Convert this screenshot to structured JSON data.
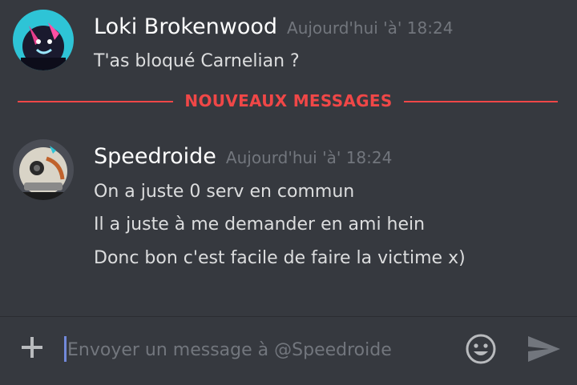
{
  "messages": [
    {
      "username": "Loki Brokenwood",
      "timestamp": "Aujourd'hui 'à' 18:24",
      "lines": [
        "T'as bloqué Carnelian ?"
      ]
    },
    {
      "username": "Speedroide",
      "timestamp": "Aujourd'hui 'à' 18:24",
      "lines": [
        "On a juste 0 serv en commun",
        "Il a juste à me demander en ami hein",
        "Donc bon c'est facile de faire la victime x)"
      ]
    }
  ],
  "divider": {
    "label": "NOUVEAUX MESSAGES"
  },
  "composer": {
    "placeholder": "Envoyer un message à @Speedroide",
    "add_icon": "plus-icon",
    "emoji_icon": "emoji-icon",
    "send_icon": "send-icon"
  },
  "colors": {
    "background": "#36393f",
    "username": "#ffffff",
    "timestamp": "#72767d",
    "message_text": "#dcddde",
    "new_messages_accent": "#f04747",
    "icons": "#b9bbbe"
  }
}
